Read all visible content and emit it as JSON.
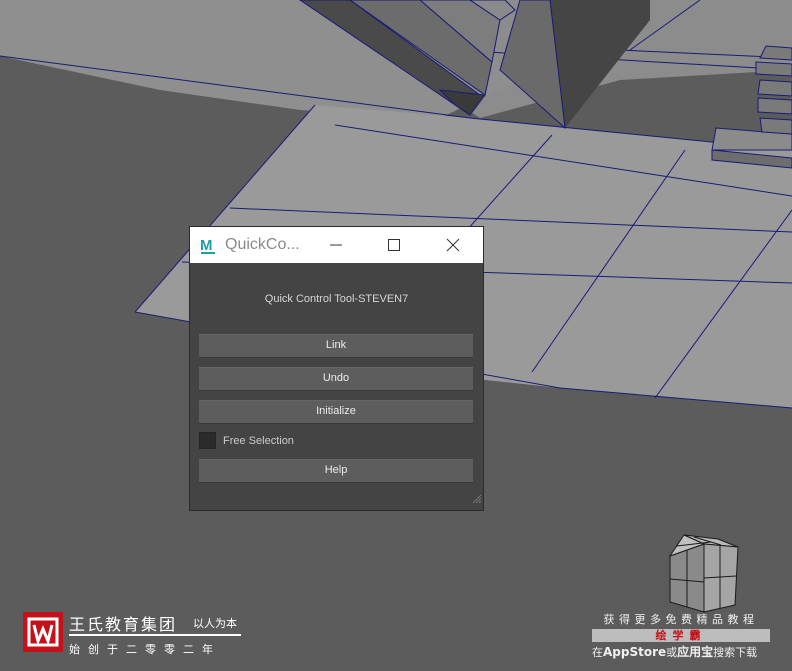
{
  "dialog": {
    "title": "QuickCo...",
    "tool_title": "Quick Control Tool-STEVEN7",
    "buttons": {
      "link": "Link",
      "undo": "Undo",
      "initialize": "Initialize",
      "help": "Help"
    },
    "checkbox": {
      "label": "Free Selection",
      "checked": false
    },
    "app_icon_letter": "M"
  },
  "watermark_left": {
    "name": "王氏教育集团",
    "slogan": "以人为本",
    "sub": "始创于二零零二年"
  },
  "watermark_right": {
    "line1": "获得更多免费精品教程",
    "brand": "绘学霸",
    "line3_prefix": "在",
    "store1": "AppStore",
    "line3_mid": "或",
    "store2": "应用宝",
    "line3_suffix": "搜索下载"
  },
  "colors": {
    "viewport_bg": "#5c5c5c",
    "grid_plane": "#9a9a9a",
    "wireframe": "#1a1a78",
    "dialog_bg": "#444444",
    "button_bg": "#5d5d5d",
    "maya_teal": "#1f9ea3",
    "brand_red": "#c4121b"
  }
}
